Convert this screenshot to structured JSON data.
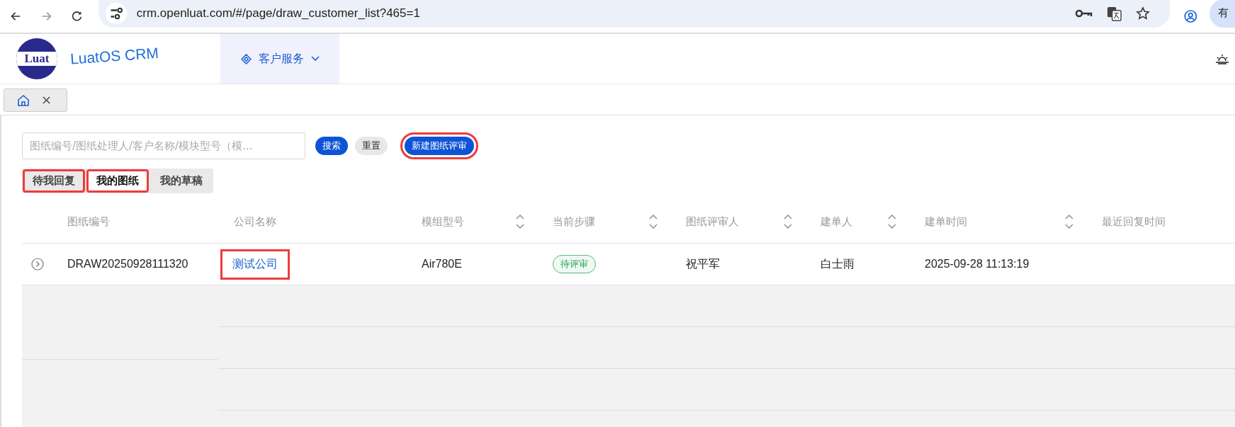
{
  "browser": {
    "url": "crm.openluat.com/#/page/draw_customer_list?465=1",
    "profile_label": "有"
  },
  "header": {
    "logo_text": "Luat",
    "brand": "LuatOS CRM",
    "menu": {
      "label": "客户服务",
      "selected": true
    }
  },
  "page_tabs": [
    {
      "kind": "home",
      "selected": true
    }
  ],
  "search": {
    "placeholder": "图纸编号/图纸处理人/客户名称/模块型号（模..."
  },
  "buttons": [
    {
      "label": "搜索",
      "kind": "primary",
      "highlighted": false
    },
    {
      "label": "重置",
      "kind": "default",
      "highlighted": false
    },
    {
      "label": "新建图纸评审",
      "kind": "primary",
      "highlighted": true
    }
  ],
  "segments": [
    {
      "label": "待我回复",
      "selected": false,
      "highlighted": true
    },
    {
      "label": "我的图纸",
      "selected": true,
      "highlighted": true
    },
    {
      "label": "我的草稿",
      "selected": false,
      "highlighted": false
    }
  ],
  "table": {
    "columns": [
      {
        "label": "图纸编号",
        "sortable": false
      },
      {
        "label": "公司名称",
        "sortable": false
      },
      {
        "label": "模组型号",
        "sortable": true
      },
      {
        "label": "当前步骤",
        "sortable": true
      },
      {
        "label": "图纸评审人",
        "sortable": true
      },
      {
        "label": "建单人",
        "sortable": true
      },
      {
        "label": "建单时间",
        "sortable": true
      },
      {
        "label": "最近回复时间",
        "sortable": false
      }
    ],
    "rows": [
      {
        "expanded": false,
        "cells": [
          {
            "kind": "text",
            "text": "DRAW20250928111320",
            "highlighted": false
          },
          {
            "kind": "link",
            "text": "测试公司",
            "highlighted": true
          },
          {
            "kind": "text",
            "text": "Air780E",
            "highlighted": false
          },
          {
            "kind": "tag",
            "text": "待评审",
            "highlighted": false
          },
          {
            "kind": "text",
            "text": "祝平军",
            "highlighted": false
          },
          {
            "kind": "text",
            "text": "白士雨",
            "highlighted": false
          },
          {
            "kind": "text",
            "text": "2025-09-28 11:13:19",
            "highlighted": false
          }
        ]
      }
    ]
  }
}
